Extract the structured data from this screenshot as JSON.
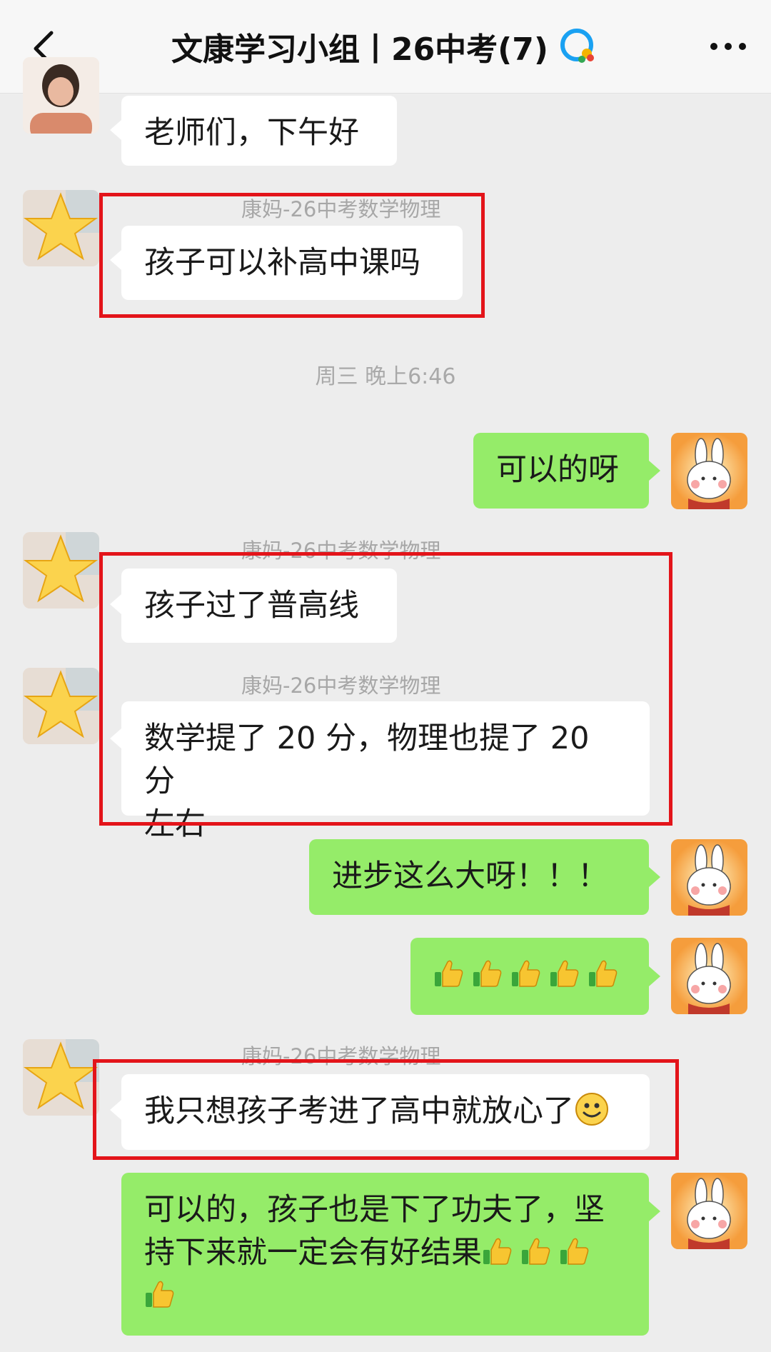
{
  "header": {
    "title": "文康学习小组丨26中考(7)",
    "back_icon": "chevron-left-icon",
    "more_icon": "more-dots-icon",
    "group_icon": "chat-bubbles-icon"
  },
  "messages": [
    {
      "type": "in",
      "text": "老师们，下午好"
    },
    {
      "type": "in",
      "sender": "康妈-26中考数学物理",
      "text": "孩子可以补高中课吗"
    },
    {
      "type": "timestamp",
      "text": "周三 晚上6:46"
    },
    {
      "type": "out",
      "text": "可以的呀"
    },
    {
      "type": "in",
      "sender": "康妈-26中考数学物理",
      "text": "孩子过了普高线"
    },
    {
      "type": "in",
      "sender": "康妈-26中考数学物理",
      "line1": "数学提了 20 分，物理也提了 20 分",
      "line2": "左右"
    },
    {
      "type": "out",
      "text": "进步这么大呀！！！"
    },
    {
      "type": "out",
      "emoji": "thumbs-up-icon",
      "count": 5
    },
    {
      "type": "in",
      "sender": "康妈-26中考数学物理",
      "text": "我只想孩子考进了高中就放心了",
      "emoji": "smile-icon"
    },
    {
      "type": "out",
      "line1": "可以的，孩子也是下了功夫了，坚",
      "line2": "持下来就一定会有好结果",
      "emoji": "thumbs-up-icon"
    }
  ],
  "colors": {
    "background": "#ededed",
    "incoming_bubble": "#ffffff",
    "outgoing_bubble": "#95ec69",
    "highlight_box": "#e3141a"
  }
}
